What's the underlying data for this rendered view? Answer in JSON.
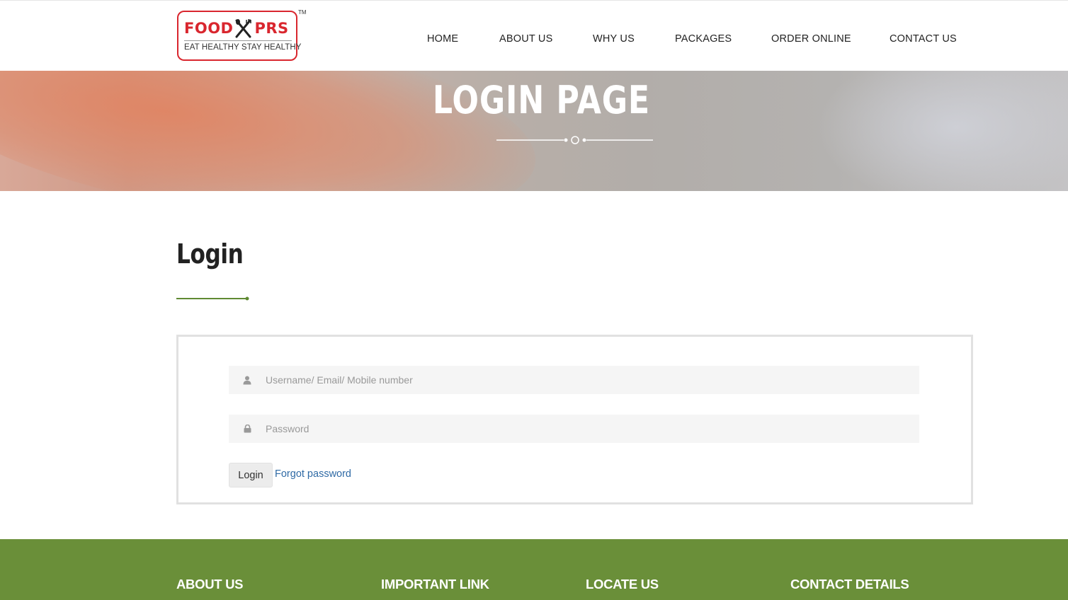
{
  "brand": {
    "name_part1": "FOOD",
    "name_part2": "PRS",
    "tagline": "EAT HEALTHY STAY HEALTHY",
    "trademark": "TM",
    "accent_color": "#d9262e"
  },
  "nav": {
    "items": [
      {
        "label": "HOME"
      },
      {
        "label": "ABOUT US"
      },
      {
        "label": "WHY US"
      },
      {
        "label": "PACKAGES"
      },
      {
        "label": "ORDER ONLINE"
      },
      {
        "label": "CONTACT US"
      }
    ]
  },
  "banner": {
    "title": "LOGIN PAGE"
  },
  "login": {
    "heading": "Login",
    "username": {
      "placeholder": "Username/ Email/ Mobile number",
      "value": "",
      "icon": "user-icon"
    },
    "password": {
      "placeholder": "Password",
      "value": "",
      "icon": "lock-icon"
    },
    "submit_label": "Login",
    "forgot_label": "Forgot password",
    "accent_color": "#5f8a33"
  },
  "footer": {
    "background_color": "#6a8f39",
    "headings": [
      "ABOUT US",
      "IMPORTANT LINK",
      "LOCATE US",
      "CONTACT DETAILS"
    ]
  }
}
